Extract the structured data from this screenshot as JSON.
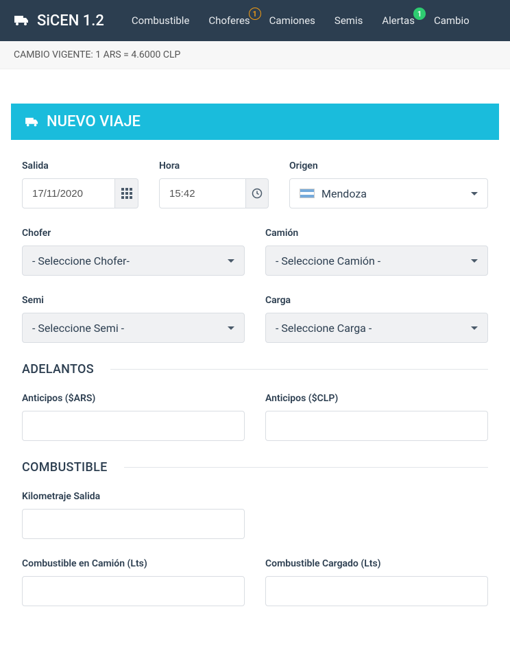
{
  "brand": "SiCEN 1.2",
  "nav": {
    "combustible": "Combustible",
    "choferes": "Choferes",
    "choferes_badge": "1",
    "camiones": "Camiones",
    "semis": "Semis",
    "alertas": "Alertas",
    "alertas_badge": "1",
    "cambio": "Cambio"
  },
  "exchange_bar": "CAMBIO VIGENTE: 1 ARS = 4.6000 CLP",
  "panel_title": "NUEVO VIAJE",
  "form": {
    "salida": {
      "label": "Salida",
      "value": "17/11/2020"
    },
    "hora": {
      "label": "Hora",
      "value": "15:42"
    },
    "origen": {
      "label": "Origen",
      "value": "Mendoza"
    },
    "chofer": {
      "label": "Chofer",
      "value": "- Seleccione Chofer-"
    },
    "camion": {
      "label": "Camión",
      "value": "- Seleccione Camión -"
    },
    "semi": {
      "label": "Semi",
      "value": "- Seleccione Semi -"
    },
    "carga": {
      "label": "Carga",
      "value": "- Seleccione Carga -"
    }
  },
  "sections": {
    "adelantos": {
      "title": "ADELANTOS",
      "anticipos_ars": {
        "label": "Anticipos ($ARS)"
      },
      "anticipos_clp": {
        "label": "Anticipos ($CLP)"
      }
    },
    "combustible": {
      "title": "COMBUSTIBLE",
      "km_salida": {
        "label": "Kilometraje Salida"
      },
      "en_camion": {
        "label": "Combustible en Camión (Lts)"
      },
      "cargado": {
        "label": "Combustible Cargado (Lts)"
      }
    }
  }
}
